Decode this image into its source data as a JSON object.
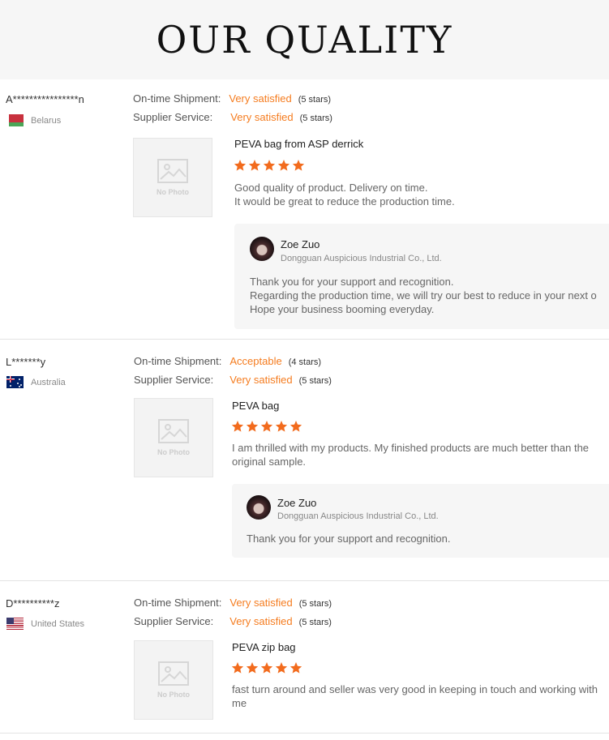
{
  "header": {
    "title": "OUR QUALITY"
  },
  "labels": {
    "on_time_shipment": "On-time Shipment:",
    "supplier_service": "Supplier Service:",
    "no_photo": "No Photo"
  },
  "reviews": [
    {
      "buyer": "A****************n",
      "country": "Belarus",
      "flag_icon": "belarus-flag-icon",
      "on_time_value": "Very satisfied",
      "on_time_stars": "(5 stars)",
      "service_value": "Very satisfied",
      "service_stars": "(5 stars)",
      "product": "PEVA bag from ASP derrick",
      "rating": 5,
      "comment_lines": [
        "Good quality of product. Delivery on time.",
        "It would be great to reduce the production time."
      ],
      "reply": {
        "name": "Zoe Zuo",
        "company": "Dongguan Auspicious Industrial Co., Ltd.",
        "lines": [
          "Thank you for your support and recognition.",
          "Regarding the production time, we will try our best to reduce in your next o",
          "Hope your business booming everyday."
        ]
      }
    },
    {
      "buyer": "L*******y",
      "country": "Australia",
      "flag_icon": "australia-flag-icon",
      "on_time_value": "Acceptable",
      "on_time_stars": "(4 stars)",
      "service_value": "Very satisfied",
      "service_stars": "(5 stars)",
      "product": "PEVA bag",
      "rating": 5,
      "comment_lines": [
        "I am thrilled with my products. My finished products are much better than the",
        "original sample."
      ],
      "reply": {
        "name": "Zoe Zuo",
        "company": "Dongguan Auspicious Industrial Co., Ltd.",
        "lines": [
          "Thank you for your support and recognition."
        ]
      }
    },
    {
      "buyer": "D**********z",
      "country": "United States",
      "flag_icon": "united-states-flag-icon",
      "on_time_value": "Very satisfied",
      "on_time_stars": "(5 stars)",
      "service_value": "Very satisfied",
      "service_stars": "(5 stars)",
      "product": "PEVA zip bag",
      "rating": 5,
      "comment_lines": [
        "fast turn around and seller was very good in keeping in touch and working with",
        "me"
      ]
    }
  ],
  "colors": {
    "accent": "#f57c1f",
    "star": "#f26b1d"
  }
}
